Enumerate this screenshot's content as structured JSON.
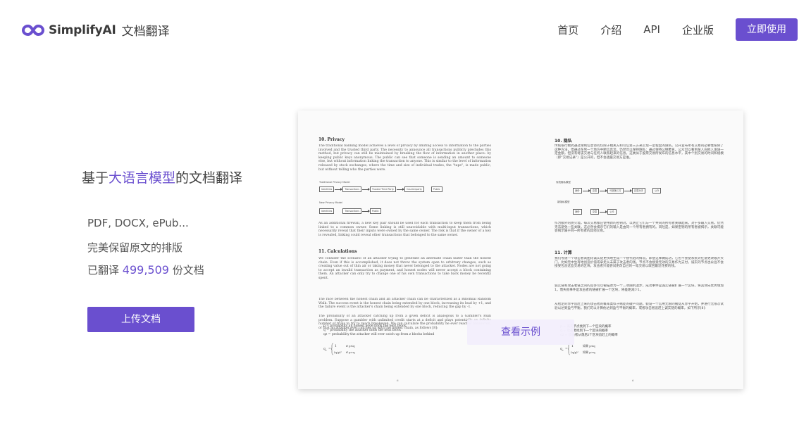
{
  "header": {
    "logo_text": "SimplifyAI",
    "logo_sub": "文档翻译",
    "nav": [
      {
        "label": "首页"
      },
      {
        "label": "介绍"
      },
      {
        "label": "API"
      },
      {
        "label": "企业版"
      }
    ],
    "cta_label": "立即使用"
  },
  "hero": {
    "title_pre": "基于",
    "title_highlight": "大语言模型",
    "title_post": "的文档翻译",
    "features": [
      "PDF, DOCX, ePub...",
      "完美保留原文的排版"
    ],
    "count_pre": "已翻译 ",
    "count_value": "499,509",
    "count_post": " 份文档",
    "upload_label": "上传文档"
  },
  "preview": {
    "left": {
      "h_privacy": "10.  Privacy",
      "p1": "The traditional banking model achieves a level of privacy by limiting access to information to the parties involved and the trusted third party. The necessity to announce all transactions publicly precludes this method, but privacy can still be maintained by breaking the flow of information in another place: by keeping public keys anonymous. The public can see that someone is sending an amount to someone else, but without information linking the transaction to anyone. This is similar to the level of information released by stock exchanges, where the time and size of individual trades, the \"tape\", is made public, but without telling who the parties were.",
      "model1_label": "Traditional Privacy Model",
      "model1_boxes": [
        "Identities",
        "Transactions",
        "Trusted Third Party",
        "Counterparty",
        "Public"
      ],
      "model2_label": "New Privacy Model",
      "model2_boxes": [
        "Identities",
        "Transactions",
        "Public"
      ],
      "p2": "As an additional firewall, a new key pair should be used for each transaction to keep them from being linked to a common owner. Some linking is still unavoidable with multi-input transactions, which necessarily reveal that their inputs were owned by the same owner. The risk is that if the owner of a key is revealed, linking could reveal other transactions that belonged to the same owner.",
      "h_calc": "11.  Calculations",
      "p3": "We consider the scenario of an attacker trying to generate an alternate chain faster than the honest chain. Even if this is accomplished, it does not throw the system open to arbitrary changes, such as creating value out of thin air or taking money that never belonged to the attacker. Nodes are not going to accept an invalid transaction as payment, and honest nodes will never accept a block containing them. An attacker can only try to change one of his own transactions to take back money he recently spent.",
      "p4": "The race between the honest chain and an attacker chain can be characterized as a Binomial Random Walk. The success event is the honest chain being extended by one block, increasing its lead by +1, and the failure event is the attacker's chain being extended by one block, reducing the gap by -1.",
      "p5": "The probability of an attacker catching up from a given deficit is analogous to a Gambler's Ruin problem. Suppose a gambler with unlimited credit starts at a deficit and plays potentially an infinite number of trials to try to reach breakeven. We can calculate the probability he ever reaches breakeven, or that an attacker ever catches up with the honest chain, as follows [8]:",
      "f1": "p = probability an honest node finds the next block",
      "f2": "q = probability the attacker finds the next block",
      "f3": "qz = probability the attacker will ever catch up from z blocks behind",
      "page_no": "6"
    },
    "right": {
      "h_privacy": "10. 隐私",
      "p1": "传统银行模式通过限制信息访问仅限于相关方和可信第三方来实现一定程度的隐私。公开宣布所有交易的必要性排除了这种方法，但通过在另一个地方中断信息流，仍然可以保持隐私：通过保持公钥匿名。公众可以看到某人向他人发送一定金额，但没有将该交易与任何人联系起来的信息。这类似于股票交易所发布的信息水平，其中个别交易的时间和规模（即“交易记录”）是公开的，但不会透露交易方是谁。",
      "model1_label": "传统隐私模型",
      "model1_boxes": [
        "身份",
        "交易",
        "可信第三方",
        "交易对手",
        "公众"
      ],
      "model2_label": "新隐私模型",
      "model2_boxes": [
        "身份",
        "交易",
        "公众"
      ],
      "p2": "作为额外的防火墙，每次交易都应使用新的密钥对，以防止它们与一个共同的所有者关联起来。对于多输入交易，仍然无法避免一些关联，这必然会揭示它们的输入是由同一个所有者拥有的。风险是，如果密钥的所有者被揭示，关联可能会揭示属于同一所有者的其他交易。",
      "h_calc": "11. 计算",
      "p3": "我们考虑一个攻击者试图比诚实链更快地生成一个替代链的情况。即使这样做成功，它也不会使系统对任意更改敞开大门，比如无中生有地创造价值或拿走从未属于攻击者的钱。节点不会接受无效的交易作为支付，诚实的节点也永远不会接受包含这些交易的区块。攻击者只能尝试更改自己的一笔交易以取回最近花费的钱。",
      "p4": "诚实链和攻击者链之间的竞争可以被描述为一个二项随机漫步。成功事件是诚实链被扩展一个区块，将其领先优势增加1，而失败事件是攻击者的链被扩展一个区块，将差距减少1。",
      "p5": "从给定的赤字追赶上来的攻击者的概率类似于赌徒的破产问题。假设一个信用无限的赌徒从赤字开始，并进行无限次试验以达到盈亏平衡。我们可以计算他达到盈亏平衡的概率，或者攻击者追赶上诚实链的概率，如下所示[8]:",
      "f1": "p = 诚实节点找到下一个区块的概率",
      "f2": "q = 攻击者找到下一个区块的概率",
      "f3": "qz = 攻击者从落后z个区块追赶上的概率",
      "page_no": "6"
    },
    "view_label": "查看示例"
  },
  "colors": {
    "accent": "#6a4fcf",
    "view_bg": "#f2eefc",
    "text": "#444444"
  }
}
